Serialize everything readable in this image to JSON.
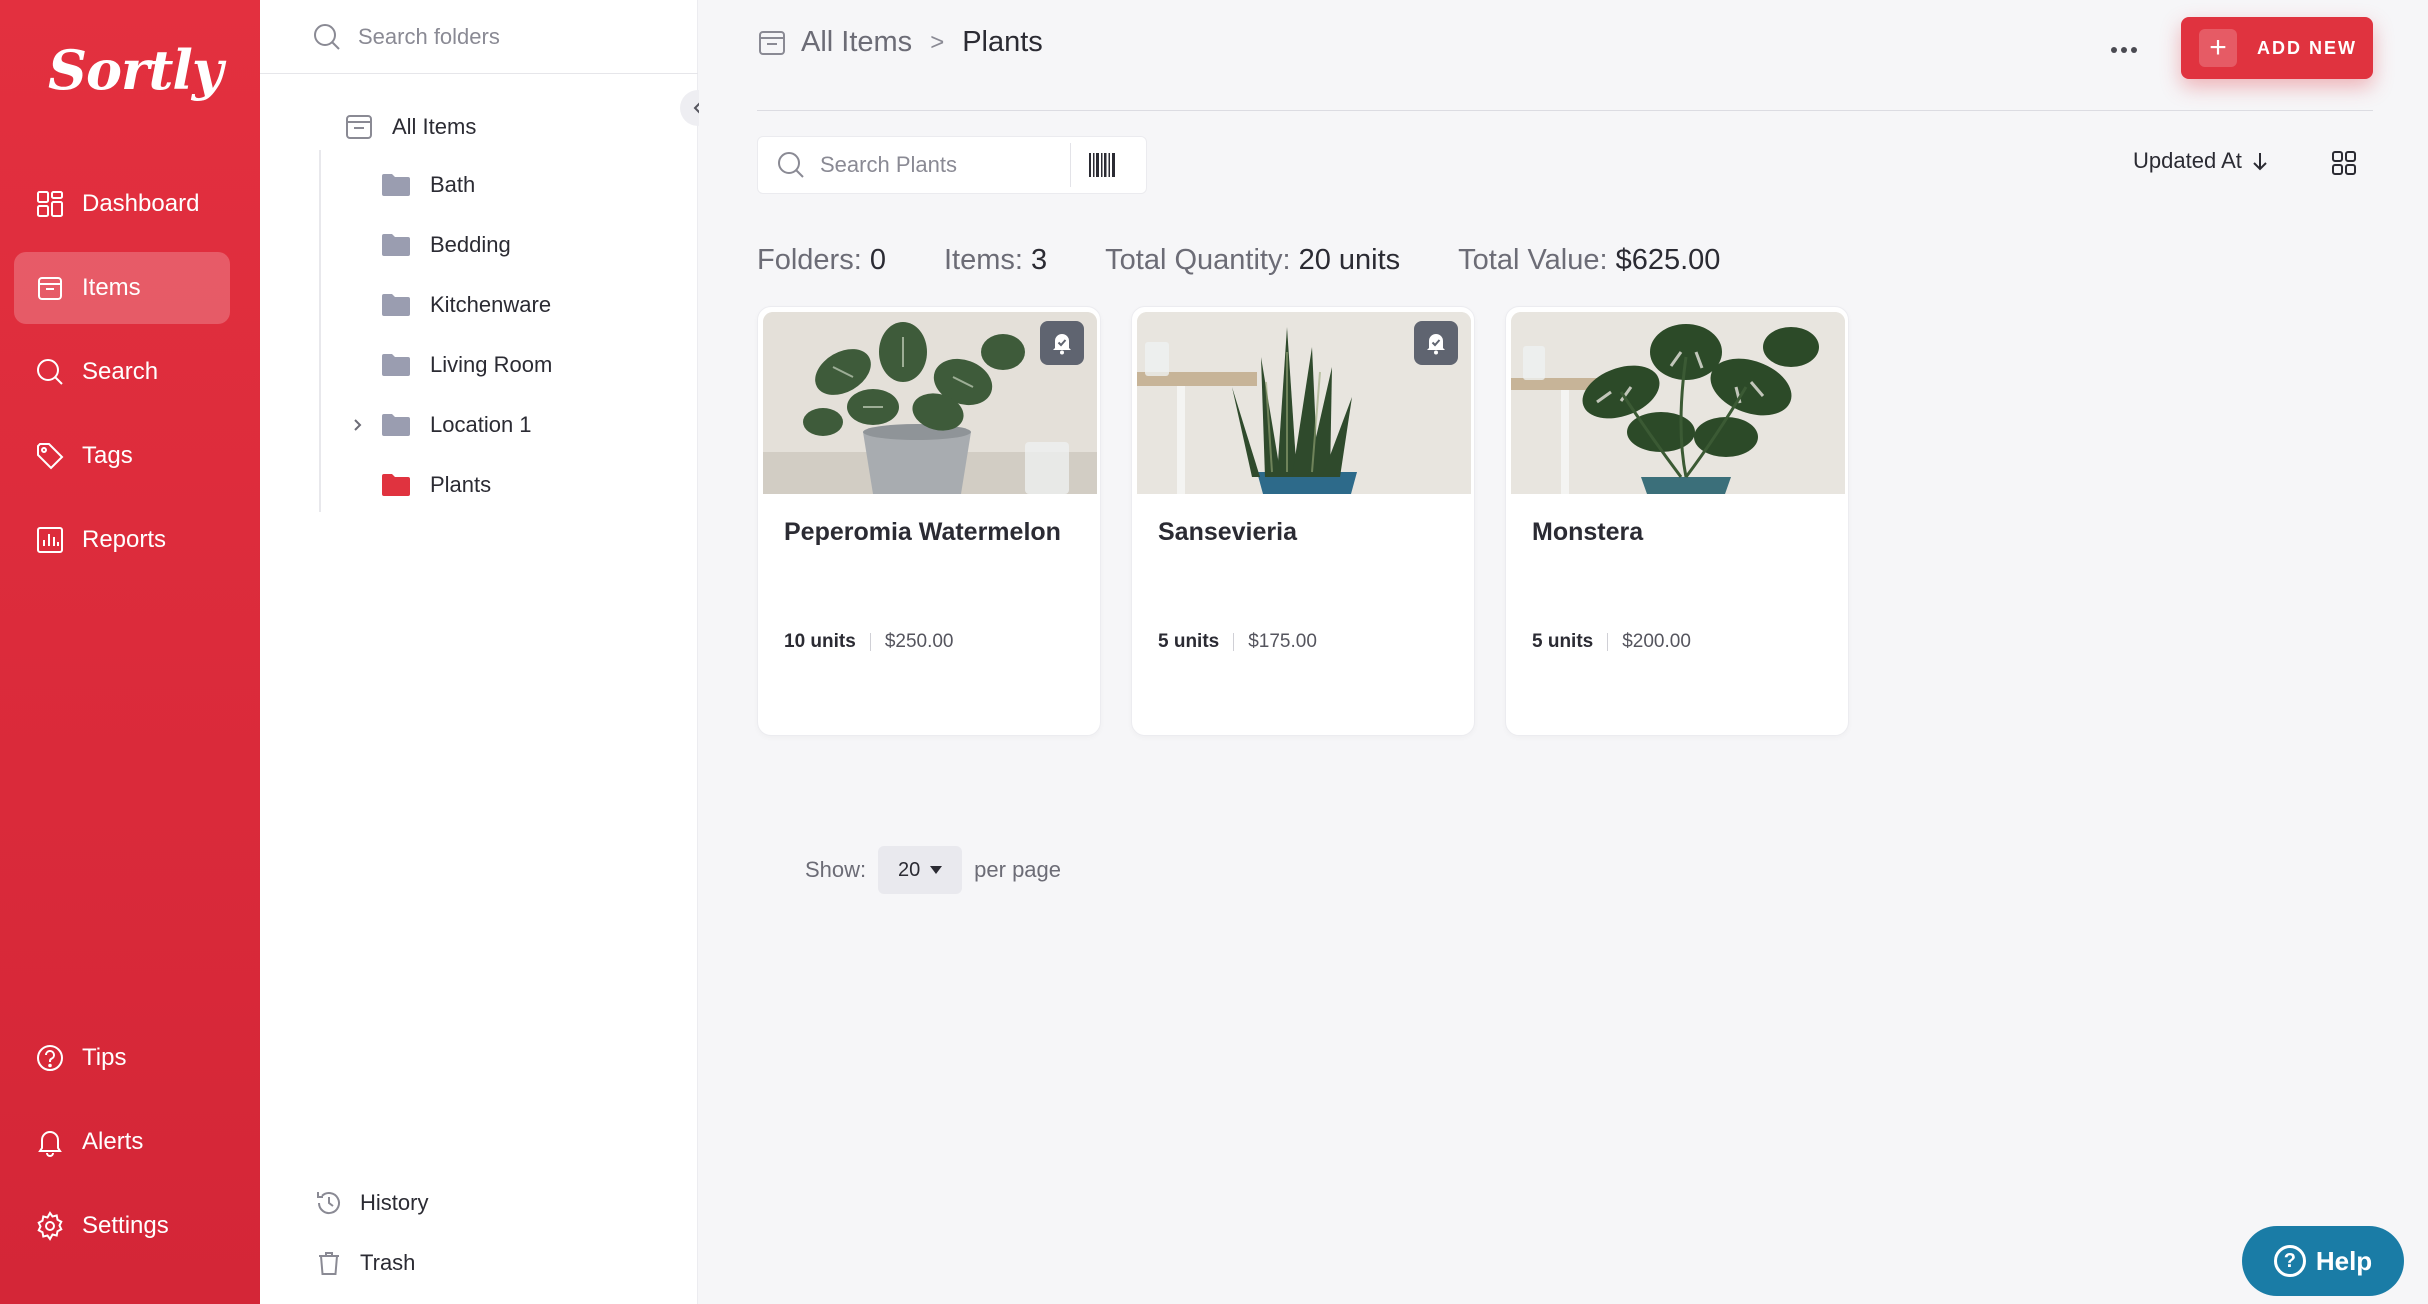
{
  "app": {
    "logo_text": "Sortly",
    "brand_color": "#e0333f"
  },
  "nav": {
    "items": [
      {
        "label": "Dashboard",
        "icon": "dashboard-icon"
      },
      {
        "label": "Items",
        "icon": "items-icon",
        "active": true
      },
      {
        "label": "Search",
        "icon": "search-icon"
      },
      {
        "label": "Tags",
        "icon": "tag-icon"
      },
      {
        "label": "Reports",
        "icon": "reports-icon"
      }
    ],
    "bottom": [
      {
        "label": "Tips",
        "icon": "help-circle-icon"
      },
      {
        "label": "Alerts",
        "icon": "bell-icon"
      },
      {
        "label": "Settings",
        "icon": "gear-icon"
      }
    ]
  },
  "folders": {
    "search_placeholder": "Search folders",
    "root": "All Items",
    "items": [
      {
        "label": "Bath",
        "color": "#9a9db0"
      },
      {
        "label": "Bedding",
        "color": "#9a9db0"
      },
      {
        "label": "Kitchenware",
        "color": "#9a9db0"
      },
      {
        "label": "Living Room",
        "color": "#9a9db0"
      },
      {
        "label": "Location 1",
        "color": "#9a9db0",
        "expandable": true
      },
      {
        "label": "Plants",
        "color": "#e0333f",
        "selected": true
      }
    ],
    "history_label": "History",
    "trash_label": "Trash"
  },
  "header": {
    "breadcrumb_root": "All Items",
    "breadcrumb_separator": ">",
    "breadcrumb_current": "Plants",
    "add_button": "ADD NEW",
    "more_button": "…"
  },
  "toolbar": {
    "search_placeholder": "Search Plants",
    "sort_label": "Updated At"
  },
  "stats": {
    "folders_label": "Folders:",
    "folders_value": "0",
    "items_label": "Items:",
    "items_value": "3",
    "quantity_label": "Total Quantity:",
    "quantity_value": "20 units",
    "value_label": "Total Value:",
    "value_value": "$625.00"
  },
  "cards": [
    {
      "name": "Peperomia Watermelon",
      "qty": "10 units",
      "value": "$250.00",
      "alert": true
    },
    {
      "name": "Sansevieria",
      "qty": "5 units",
      "value": "$175.00",
      "alert": true
    },
    {
      "name": "Monstera",
      "qty": "5 units",
      "value": "$200.00",
      "alert": false
    }
  ],
  "pagination": {
    "show_label": "Show:",
    "per_page_value": "20",
    "per_page_label": "per page"
  },
  "help": {
    "label": "Help",
    "color": "#1a7ca6"
  }
}
